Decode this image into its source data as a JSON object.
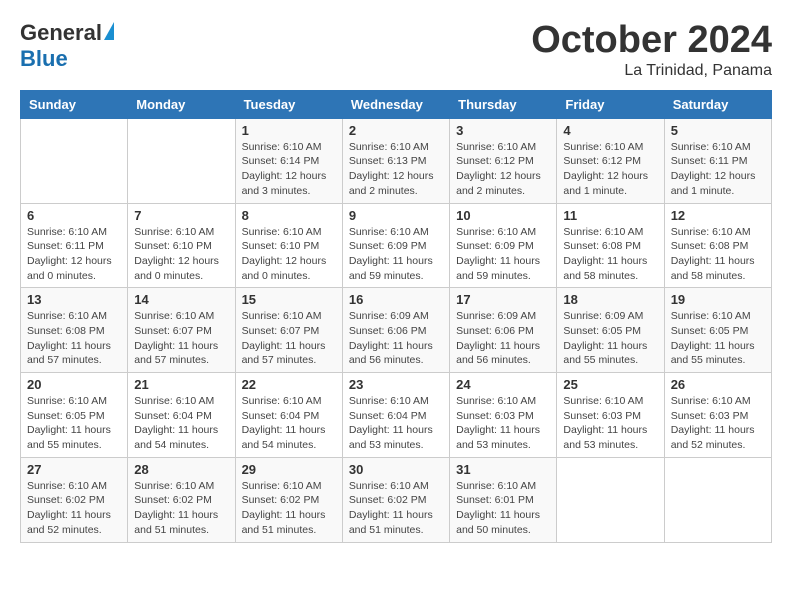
{
  "header": {
    "logo_general": "General",
    "logo_blue": "Blue",
    "month_title": "October 2024",
    "location": "La Trinidad, Panama"
  },
  "weekdays": [
    "Sunday",
    "Monday",
    "Tuesday",
    "Wednesday",
    "Thursday",
    "Friday",
    "Saturday"
  ],
  "weeks": [
    [
      {
        "day": "",
        "info": ""
      },
      {
        "day": "",
        "info": ""
      },
      {
        "day": "1",
        "info": "Sunrise: 6:10 AM\nSunset: 6:14 PM\nDaylight: 12 hours\nand 3 minutes."
      },
      {
        "day": "2",
        "info": "Sunrise: 6:10 AM\nSunset: 6:13 PM\nDaylight: 12 hours\nand 2 minutes."
      },
      {
        "day": "3",
        "info": "Sunrise: 6:10 AM\nSunset: 6:12 PM\nDaylight: 12 hours\nand 2 minutes."
      },
      {
        "day": "4",
        "info": "Sunrise: 6:10 AM\nSunset: 6:12 PM\nDaylight: 12 hours\nand 1 minute."
      },
      {
        "day": "5",
        "info": "Sunrise: 6:10 AM\nSunset: 6:11 PM\nDaylight: 12 hours\nand 1 minute."
      }
    ],
    [
      {
        "day": "6",
        "info": "Sunrise: 6:10 AM\nSunset: 6:11 PM\nDaylight: 12 hours\nand 0 minutes."
      },
      {
        "day": "7",
        "info": "Sunrise: 6:10 AM\nSunset: 6:10 PM\nDaylight: 12 hours\nand 0 minutes."
      },
      {
        "day": "8",
        "info": "Sunrise: 6:10 AM\nSunset: 6:10 PM\nDaylight: 12 hours\nand 0 minutes."
      },
      {
        "day": "9",
        "info": "Sunrise: 6:10 AM\nSunset: 6:09 PM\nDaylight: 11 hours\nand 59 minutes."
      },
      {
        "day": "10",
        "info": "Sunrise: 6:10 AM\nSunset: 6:09 PM\nDaylight: 11 hours\nand 59 minutes."
      },
      {
        "day": "11",
        "info": "Sunrise: 6:10 AM\nSunset: 6:08 PM\nDaylight: 11 hours\nand 58 minutes."
      },
      {
        "day": "12",
        "info": "Sunrise: 6:10 AM\nSunset: 6:08 PM\nDaylight: 11 hours\nand 58 minutes."
      }
    ],
    [
      {
        "day": "13",
        "info": "Sunrise: 6:10 AM\nSunset: 6:08 PM\nDaylight: 11 hours\nand 57 minutes."
      },
      {
        "day": "14",
        "info": "Sunrise: 6:10 AM\nSunset: 6:07 PM\nDaylight: 11 hours\nand 57 minutes."
      },
      {
        "day": "15",
        "info": "Sunrise: 6:10 AM\nSunset: 6:07 PM\nDaylight: 11 hours\nand 57 minutes."
      },
      {
        "day": "16",
        "info": "Sunrise: 6:09 AM\nSunset: 6:06 PM\nDaylight: 11 hours\nand 56 minutes."
      },
      {
        "day": "17",
        "info": "Sunrise: 6:09 AM\nSunset: 6:06 PM\nDaylight: 11 hours\nand 56 minutes."
      },
      {
        "day": "18",
        "info": "Sunrise: 6:09 AM\nSunset: 6:05 PM\nDaylight: 11 hours\nand 55 minutes."
      },
      {
        "day": "19",
        "info": "Sunrise: 6:10 AM\nSunset: 6:05 PM\nDaylight: 11 hours\nand 55 minutes."
      }
    ],
    [
      {
        "day": "20",
        "info": "Sunrise: 6:10 AM\nSunset: 6:05 PM\nDaylight: 11 hours\nand 55 minutes."
      },
      {
        "day": "21",
        "info": "Sunrise: 6:10 AM\nSunset: 6:04 PM\nDaylight: 11 hours\nand 54 minutes."
      },
      {
        "day": "22",
        "info": "Sunrise: 6:10 AM\nSunset: 6:04 PM\nDaylight: 11 hours\nand 54 minutes."
      },
      {
        "day": "23",
        "info": "Sunrise: 6:10 AM\nSunset: 6:04 PM\nDaylight: 11 hours\nand 53 minutes."
      },
      {
        "day": "24",
        "info": "Sunrise: 6:10 AM\nSunset: 6:03 PM\nDaylight: 11 hours\nand 53 minutes."
      },
      {
        "day": "25",
        "info": "Sunrise: 6:10 AM\nSunset: 6:03 PM\nDaylight: 11 hours\nand 53 minutes."
      },
      {
        "day": "26",
        "info": "Sunrise: 6:10 AM\nSunset: 6:03 PM\nDaylight: 11 hours\nand 52 minutes."
      }
    ],
    [
      {
        "day": "27",
        "info": "Sunrise: 6:10 AM\nSunset: 6:02 PM\nDaylight: 11 hours\nand 52 minutes."
      },
      {
        "day": "28",
        "info": "Sunrise: 6:10 AM\nSunset: 6:02 PM\nDaylight: 11 hours\nand 51 minutes."
      },
      {
        "day": "29",
        "info": "Sunrise: 6:10 AM\nSunset: 6:02 PM\nDaylight: 11 hours\nand 51 minutes."
      },
      {
        "day": "30",
        "info": "Sunrise: 6:10 AM\nSunset: 6:02 PM\nDaylight: 11 hours\nand 51 minutes."
      },
      {
        "day": "31",
        "info": "Sunrise: 6:10 AM\nSunset: 6:01 PM\nDaylight: 11 hours\nand 50 minutes."
      },
      {
        "day": "",
        "info": ""
      },
      {
        "day": "",
        "info": ""
      }
    ]
  ]
}
